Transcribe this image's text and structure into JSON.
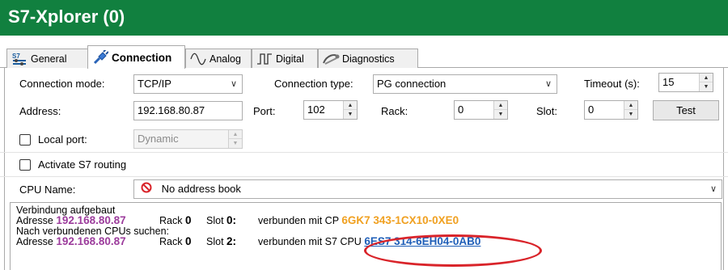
{
  "window": {
    "title": "S7-Xplorer (0)",
    "accent": "#11803f"
  },
  "tabs": [
    {
      "label": "General",
      "icon": "s7-icon",
      "active": false
    },
    {
      "label": "Connection",
      "icon": "plug-icon",
      "active": true
    },
    {
      "label": "Analog",
      "icon": "sine-wave-icon",
      "active": false
    },
    {
      "label": "Digital",
      "icon": "square-wave-icon",
      "active": false
    },
    {
      "label": "Diagnostics",
      "icon": "diagnostics-icon",
      "active": false
    }
  ],
  "connection": {
    "mode_label": "Connection mode:",
    "mode_value": "TCP/IP",
    "type_label": "Connection type:",
    "type_value": "PG connection",
    "timeout_label": "Timeout (s):",
    "timeout_value": "15",
    "address_label": "Address:",
    "address_value": "192.168.80.87",
    "port_label": "Port:",
    "port_value": "102",
    "rack_label": "Rack:",
    "rack_value": "0",
    "slot_label": "Slot:",
    "slot_value": "0",
    "test_label": "Test",
    "local_port_label": "Local port:",
    "local_port_checked": false,
    "local_port_value": "Dynamic",
    "s7_routing_label": "Activate S7 routing",
    "s7_routing_checked": false,
    "cpu_name_label": "CPU Name:",
    "cpu_name_value": "No address book",
    "cpu_name_icon": "no-entry-icon"
  },
  "log": {
    "line1": "Verbindung aufgebaut",
    "line2": {
      "address_label": "Adresse",
      "address": "192.168.80.87",
      "rack_label": "Rack",
      "rack": "0",
      "slot_label": "Slot",
      "slot": "0:",
      "text": "verbunden mit CP",
      "product": "6GK7 343-1CX10-0XE0"
    },
    "line3": "Nach verbundenen CPUs suchen:",
    "line4": {
      "address_label": "Adresse",
      "address": "192.168.80.87",
      "rack_label": "Rack",
      "rack": "0",
      "slot_label": "Slot",
      "slot": "2:",
      "text": "verbunden mit S7 CPU",
      "product": "6ES7 314-6EH04-0AB0"
    }
  },
  "colors": {
    "address_purple": "#9c3c9c",
    "cp_orange": "#f0a020",
    "link_blue": "#1f5fb8",
    "highlight_red": "#d9242a"
  }
}
